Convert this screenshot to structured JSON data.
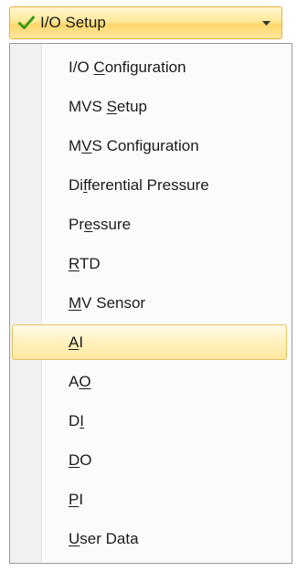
{
  "header": {
    "title": "I/O Setup",
    "check_icon": "checkmark-icon",
    "dropdown_icon": "chevron-down-icon",
    "check_color": "#3a9a1e",
    "highlight_color": "#ffd76a"
  },
  "menu": {
    "selected_index": 7,
    "items": [
      {
        "pre": "I/O ",
        "key": "C",
        "post": "onfiguration"
      },
      {
        "pre": "MVS ",
        "key": "S",
        "post": "etup"
      },
      {
        "pre": "M",
        "key": "V",
        "post": "S Configuration"
      },
      {
        "pre": "Di",
        "key": "f",
        "post": "ferential Pressure"
      },
      {
        "pre": "Pr",
        "key": "e",
        "post": "ssure"
      },
      {
        "pre": "",
        "key": "R",
        "post": "TD"
      },
      {
        "pre": "",
        "key": "M",
        "post": "V Sensor"
      },
      {
        "pre": "",
        "key": "A",
        "post": "I"
      },
      {
        "pre": "A",
        "key": "O",
        "post": ""
      },
      {
        "pre": "D",
        "key": "I",
        "post": ""
      },
      {
        "pre": "",
        "key": "D",
        "post": "O"
      },
      {
        "pre": "",
        "key": "P",
        "post": "I"
      },
      {
        "pre": "",
        "key": "U",
        "post": "ser Data"
      }
    ]
  }
}
